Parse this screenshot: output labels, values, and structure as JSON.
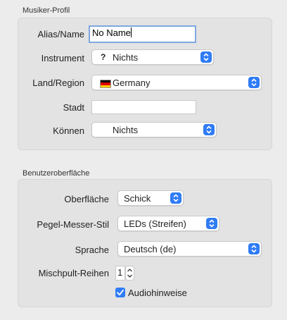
{
  "profile": {
    "section_title": "Musiker-Profil",
    "alias_label": "Alias/Name",
    "alias_value": "No Name",
    "instrument_label": "Instrument",
    "instrument_value": "Nichts",
    "instrument_icon": "?",
    "country_label": "Land/Region",
    "country_value": "Germany",
    "flag_colors": [
      "#000000",
      "#dd0000",
      "#ffce00"
    ],
    "city_label": "Stadt",
    "city_value": "",
    "skill_label": "Können",
    "skill_value": "Nichts"
  },
  "ui": {
    "section_title": "Benutzeroberfläche",
    "skin_label": "Oberfläche",
    "skin_value": "Schick",
    "meter_label": "Pegel-Messer-Stil",
    "meter_value": "LEDs (Streifen)",
    "language_label": "Sprache",
    "language_value": "Deutsch (de)",
    "mixer_rows_label": "Mischpult-Reihen",
    "mixer_rows_value": "1",
    "audio_alerts_label": "Audiohinweise",
    "audio_alerts_checked": true
  },
  "colors": {
    "accent": "#2f7cf6",
    "focus_ring": "#7fa7e0"
  }
}
